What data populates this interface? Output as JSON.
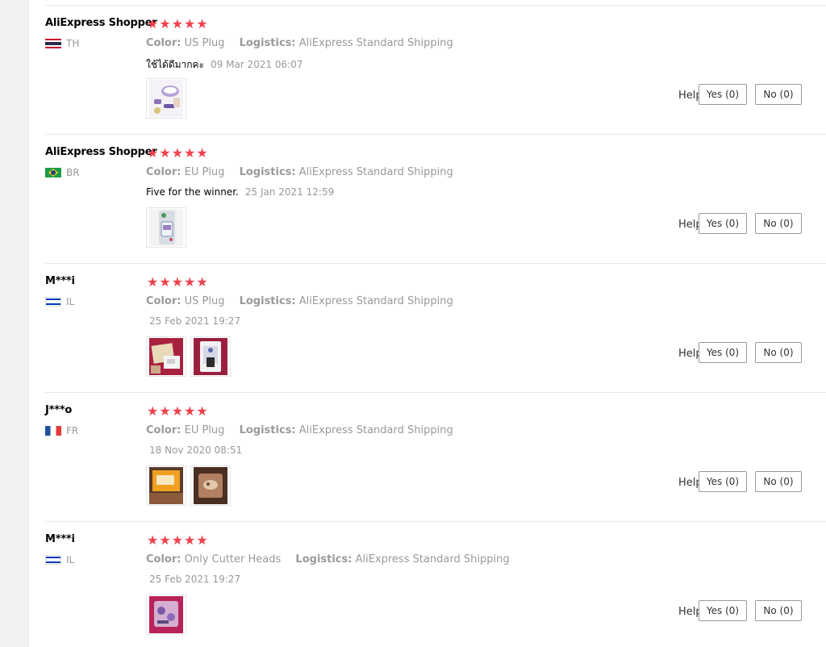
{
  "labels": {
    "color": "Color:",
    "logistics": "Logistics:",
    "helpful": "Helpful?"
  },
  "reviews": [
    {
      "user": "AliExpress Shopper",
      "country_code": "TH",
      "flag": "thailand-flag-icon",
      "rating_stars": "★★★★★",
      "color": "US Plug",
      "logistics": "AliExpress Standard Shipping",
      "comment": "ใช้ได้ดีมากคะ",
      "date": "09 Mar 2021 06:07",
      "photos": [
        "purple epilator with accessories"
      ],
      "yes": "Yes (0)",
      "no": "No (0)"
    },
    {
      "user": "AliExpress Shopper",
      "country_code": "BR",
      "flag": "brazil-flag-icon",
      "rating_stars": "★★★★★",
      "color": "EU Plug",
      "logistics": "AliExpress Standard Shipping",
      "comment": "Five for the winner.",
      "date": "25 Jan 2021 12:59",
      "photos": [
        "product package"
      ],
      "yes": "Yes (0)",
      "no": "No (0)"
    },
    {
      "user": "M***i",
      "country_code": "IL",
      "flag": "israel-flag-icon",
      "rating_stars": "★★★★★",
      "color": "US Plug",
      "logistics": "AliExpress Standard Shipping",
      "comment": "",
      "date": "25 Feb 2021 19:27",
      "photos": [
        "unboxed items",
        "device on pink cloth"
      ],
      "yes": "Yes (0)",
      "no": "No (0)"
    },
    {
      "user": "J***o",
      "country_code": "FR",
      "flag": "france-flag-icon",
      "rating_stars": "★★★★★",
      "color": "EU Plug",
      "logistics": "AliExpress Standard Shipping",
      "comment": "",
      "date": "18 Nov 2020 08:51",
      "photos": [
        "yellow package",
        "brown package"
      ],
      "yes": "Yes (0)",
      "no": "No (0)"
    },
    {
      "user": "M***i",
      "country_code": "IL",
      "flag": "israel-flag-icon",
      "rating_stars": "★★★★★",
      "color": "Only Cutter Heads",
      "logistics": "AliExpress Standard Shipping",
      "comment": "",
      "date": "25 Feb 2021 19:27",
      "photos": [
        "cutter heads in bag"
      ],
      "yes": "Yes (0)",
      "no": "No (0)"
    }
  ]
}
